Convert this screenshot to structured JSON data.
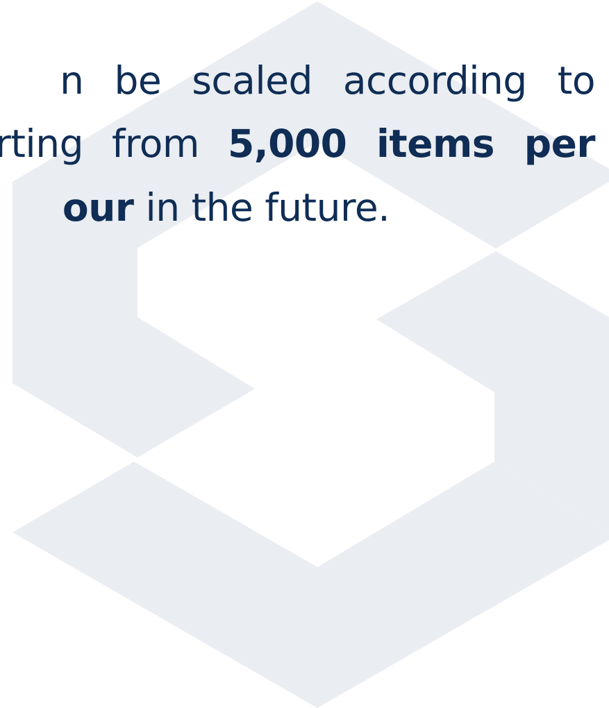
{
  "paragraph": {
    "line1": "n be scaled according to",
    "line2": {
      "lead": "rting from ",
      "bold": "5,000 items per"
    },
    "line3": {
      "bold": "our",
      "rest": " in the future."
    }
  },
  "colors": {
    "text": "#0f2d55",
    "watermark": "#eaedf1",
    "background": "#ffffff"
  },
  "watermark_icon": "hexagon-s-logo-icon"
}
